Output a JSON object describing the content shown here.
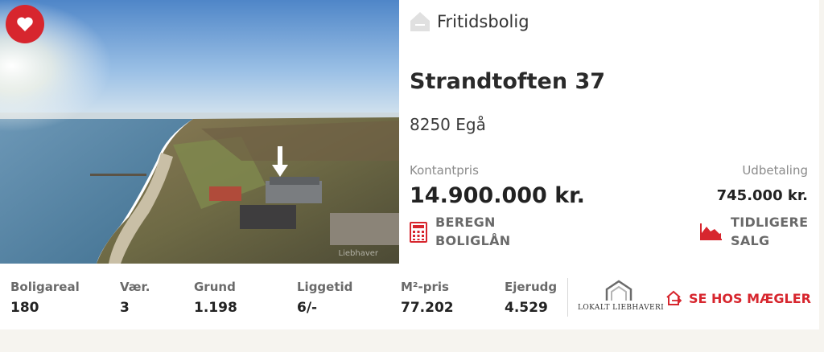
{
  "listing": {
    "property_type": "Fritidsbolig",
    "street": "Strandtoften 37",
    "city": "8250 Egå",
    "cash_price_label": "Kontantpris",
    "cash_price": "14.900.000 kr.",
    "down_payment_label": "Udbetaling",
    "down_payment": "745.000 kr.",
    "calc_loan_line1": "BEREGN",
    "calc_loan_line2": "BOLIGLÅN",
    "prev_sales_line1": "TIDLIGERE",
    "prev_sales_line2": "SALG"
  },
  "photo": {
    "watermark": "Liebhaver"
  },
  "stats": [
    {
      "label": "Boligareal",
      "value": "180"
    },
    {
      "label": "Vær.",
      "value": "3"
    },
    {
      "label": "Grund",
      "value": "1.198"
    },
    {
      "label": "Liggetid",
      "value": "6/-"
    },
    {
      "label": "M²-pris",
      "value": "77.202"
    },
    {
      "label": "Ejerudg",
      "value": "4.529"
    }
  ],
  "broker": {
    "logo_text": "LOKALT LIEBHAVERI",
    "cta": "SE HOS MÆGLER"
  },
  "colors": {
    "accent": "#d7262e",
    "text": "#222222",
    "muted": "#8a8a8a"
  },
  "icons": [
    "heart-icon",
    "house-icon",
    "calculator-icon",
    "chart-icon",
    "external-link-icon"
  ]
}
